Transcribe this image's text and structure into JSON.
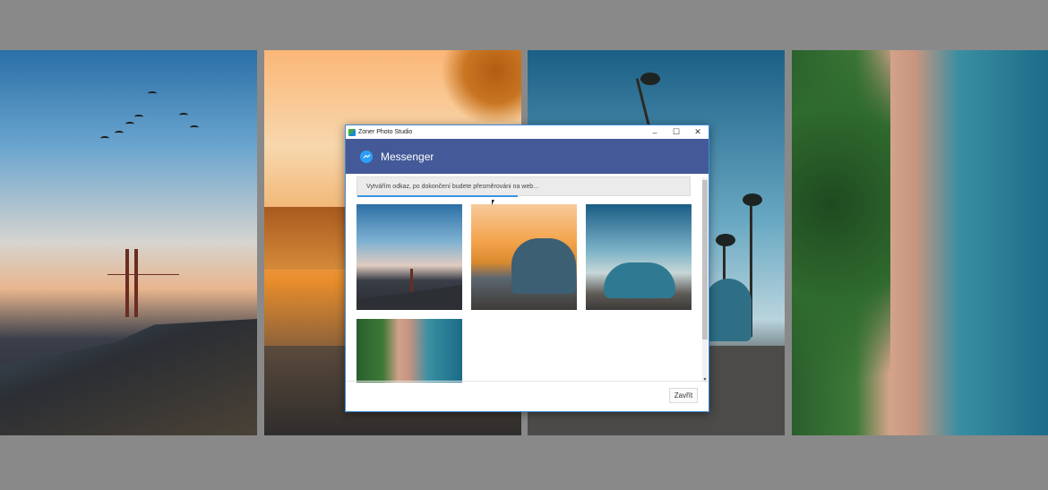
{
  "window": {
    "title": "Zoner Photo Studio",
    "minimize_label": "–",
    "maximize_label": "☐",
    "close_label": "✕"
  },
  "header": {
    "title": "Messenger",
    "icon": "messenger-icon"
  },
  "progress": {
    "message": "Vytvářím odkaz, po dokončení budete přesměrováni na web…",
    "value": 0.48
  },
  "thumbnails": [
    {
      "name": "golden-gate-bridge"
    },
    {
      "name": "car-on-sunset-road"
    },
    {
      "name": "vintage-car-with-palms"
    },
    {
      "name": "aerial-coastline"
    }
  ],
  "footer": {
    "close_button": "Zavřít"
  },
  "colors": {
    "header_bg": "#445a98",
    "accent": "#3a93e0",
    "messenger_blue": "#2d9ef8"
  }
}
